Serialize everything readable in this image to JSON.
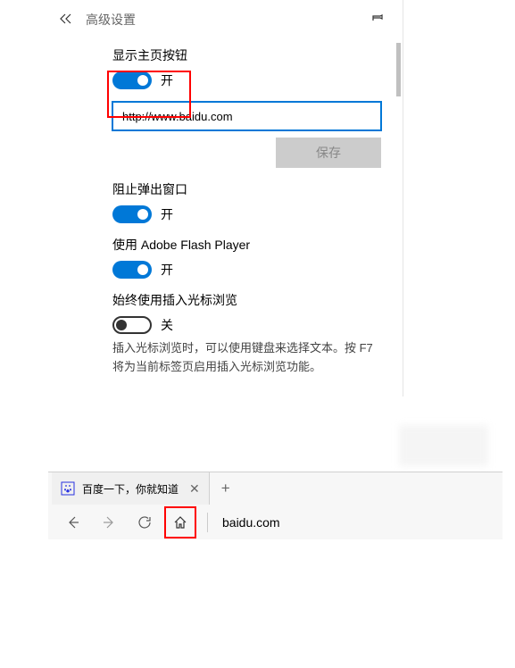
{
  "panel": {
    "title": "高级设置"
  },
  "homeButton": {
    "label": "显示主页按钮",
    "state": "开",
    "url": "http://www.baidu.com",
    "saveLabel": "保存"
  },
  "popupBlock": {
    "label": "阻止弹出窗口",
    "state": "开"
  },
  "flash": {
    "label": "使用 Adobe Flash Player",
    "state": "开"
  },
  "caret": {
    "label": "始终使用插入光标浏览",
    "state": "关",
    "help": "插入光标浏览时，可以使用键盘来选择文本。按 F7 将为当前标签页启用插入光标浏览功能。"
  },
  "browser": {
    "tabTitle": "百度一下，你就知道",
    "addressText": "baidu.com"
  }
}
